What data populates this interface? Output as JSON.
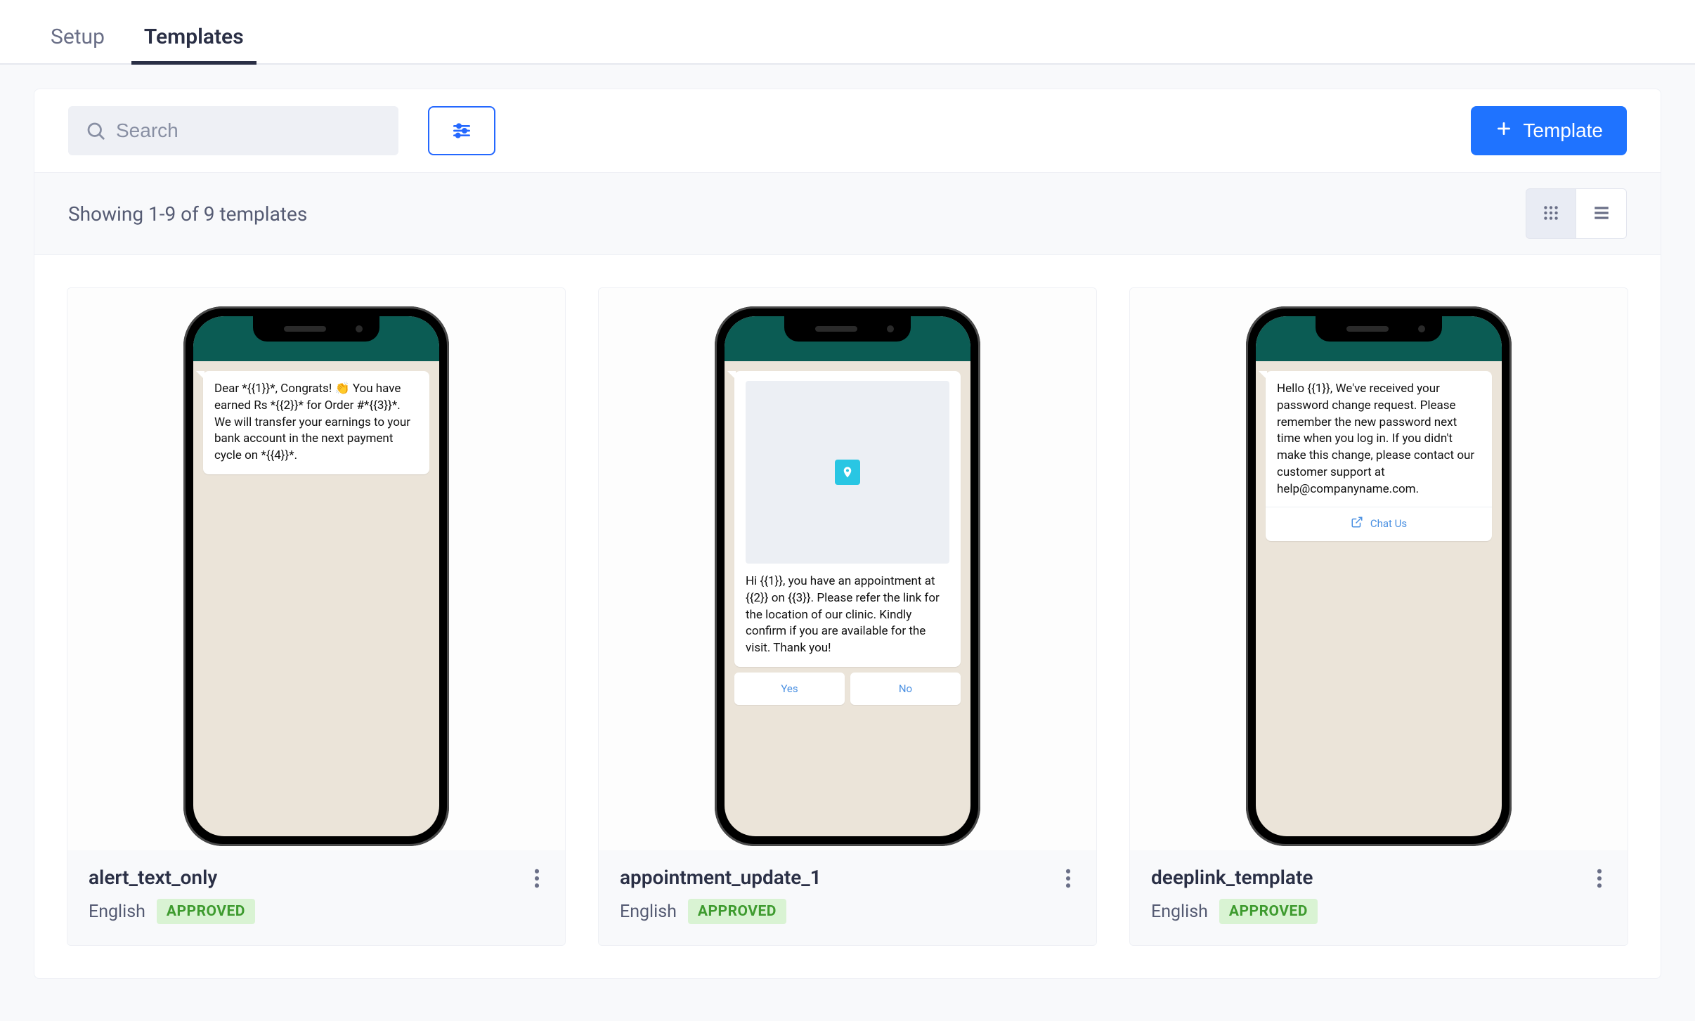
{
  "tabs": {
    "setup": "Setup",
    "templates": "Templates"
  },
  "toolbar": {
    "search_placeholder": "Search",
    "new_template_label": "Template"
  },
  "results": {
    "summary": "Showing 1-9 of 9 templates"
  },
  "templates": [
    {
      "name": "alert_text_only",
      "language": "English",
      "status": "APPROVED",
      "preview": {
        "type": "text",
        "body": "Dear *{{1}}*, Congrats! 👏 You have earned Rs *{{2}}* for Order #*{{3}}*. We will transfer your earnings to your bank account in the next payment cycle on *{{4}}*."
      }
    },
    {
      "name": "appointment_update_1",
      "language": "English",
      "status": "APPROVED",
      "preview": {
        "type": "media_buttons",
        "body": "Hi {{1}}, you have an appointment at {{2}} on {{3}}. Please refer the link for the location of our clinic. Kindly confirm if you are available for the visit. Thank you!",
        "buttons": [
          "Yes",
          "No"
        ]
      }
    },
    {
      "name": "deeplink_template",
      "language": "English",
      "status": "APPROVED",
      "preview": {
        "type": "text_link",
        "body": "Hello {{1}}, We've received your password change request. Please remember the new password next\ntime when you log in. If you didn't make this change, please contact our customer support at\nhelp@companyname.com.",
        "link_label": "Chat Us"
      }
    }
  ]
}
